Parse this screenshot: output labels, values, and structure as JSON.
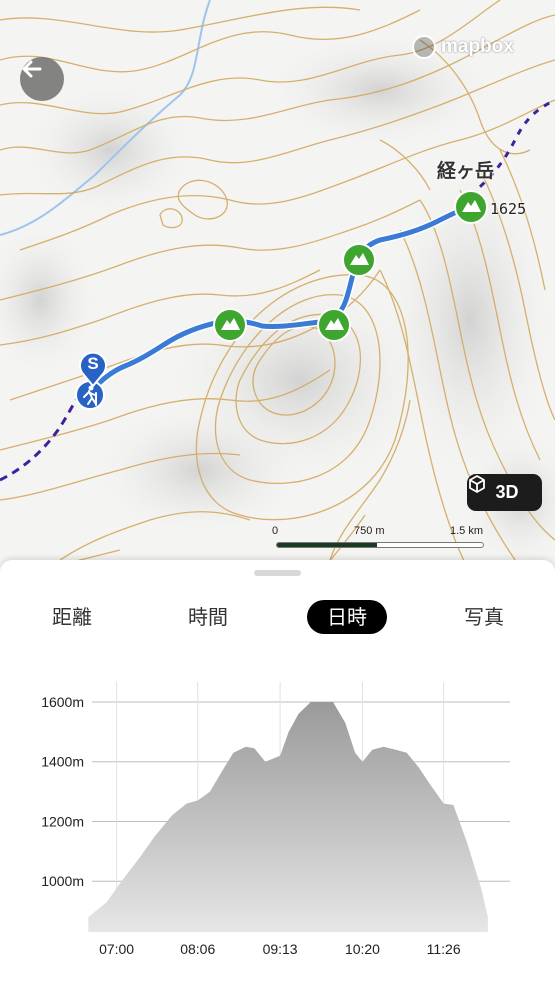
{
  "map": {
    "attribution": "mapbox",
    "peak_name": "経ヶ岳",
    "peak_elevation": "1625",
    "btn_3d_label": "3D",
    "start_marker_letter": "S",
    "scale": {
      "label_0": "0",
      "label_mid": "750 m",
      "label_max": "1.5 km"
    },
    "route_color": "#3a7bd5",
    "trail_color": "#3d22a0",
    "peak_marker_color": "#3ea62f",
    "start_marker_color": "#2762c4"
  },
  "tabs": [
    {
      "label": "距離",
      "active": false
    },
    {
      "label": "時間",
      "active": false
    },
    {
      "label": "日時",
      "active": true
    },
    {
      "label": "写真",
      "active": false
    }
  ],
  "chart_data": {
    "type": "area",
    "xlabel": "",
    "ylabel": "",
    "x_ticks": [
      "07:00",
      "08:06",
      "09:13",
      "10:20",
      "11:26"
    ],
    "y_ticks": [
      "1000m",
      "1200m",
      "1400m",
      "1600m"
    ],
    "ylim": [
      830,
      1640
    ],
    "xlim_minutes": [
      400,
      740
    ],
    "grid": true,
    "series": [
      {
        "x": [
          "06:37",
          "06:52",
          "07:04",
          "07:19",
          "07:31",
          "07:45",
          "07:57",
          "08:06",
          "08:16",
          "08:26",
          "08:35",
          "08:45",
          "08:52",
          "09:01",
          "09:13",
          "09:20",
          "09:28",
          "09:38",
          "09:46",
          "09:56",
          "10:06",
          "10:14",
          "10:20",
          "10:28",
          "10:37",
          "10:47",
          "10:56",
          "11:06",
          "11:14",
          "11:26",
          "11:34",
          "11:45",
          "11:57",
          "12:02"
        ],
        "y": [
          880,
          930,
          1000,
          1080,
          1150,
          1220,
          1260,
          1270,
          1300,
          1370,
          1430,
          1450,
          1445,
          1400,
          1420,
          1500,
          1560,
          1600,
          1600,
          1600,
          1530,
          1430,
          1400,
          1440,
          1450,
          1440,
          1430,
          1380,
          1330,
          1260,
          1255,
          1130,
          970,
          880
        ]
      }
    ]
  }
}
